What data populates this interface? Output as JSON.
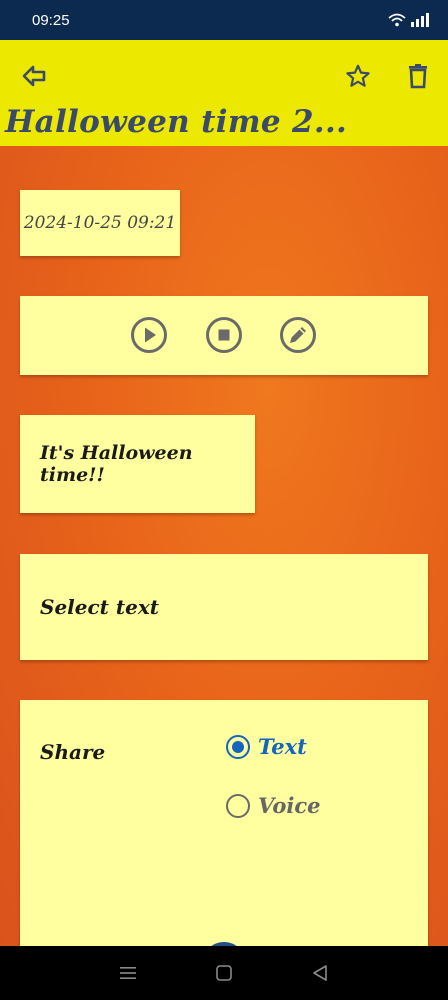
{
  "status_bar": {
    "time": "09:25"
  },
  "app_bar": {
    "title": "Halloween time 2...",
    "back_icon": "arrow-back-icon",
    "favorite_icon": "star-outline-icon",
    "delete_icon": "trash-icon"
  },
  "note": {
    "date": "2024-10-25 09:21",
    "message": "It's Halloween time!!",
    "select_text_label": "Select text"
  },
  "controls": {
    "play_icon": "play-icon",
    "stop_icon": "stop-icon",
    "edit_icon": "pencil-icon"
  },
  "share": {
    "label": "Share",
    "options": [
      "Text",
      "Voice"
    ],
    "selected": "Text"
  },
  "colors": {
    "app_bar": "#ece800",
    "background": "#e8641a",
    "card": "#ffffa0",
    "accent": "#1565c0",
    "title_text": "#3a4a6a"
  }
}
